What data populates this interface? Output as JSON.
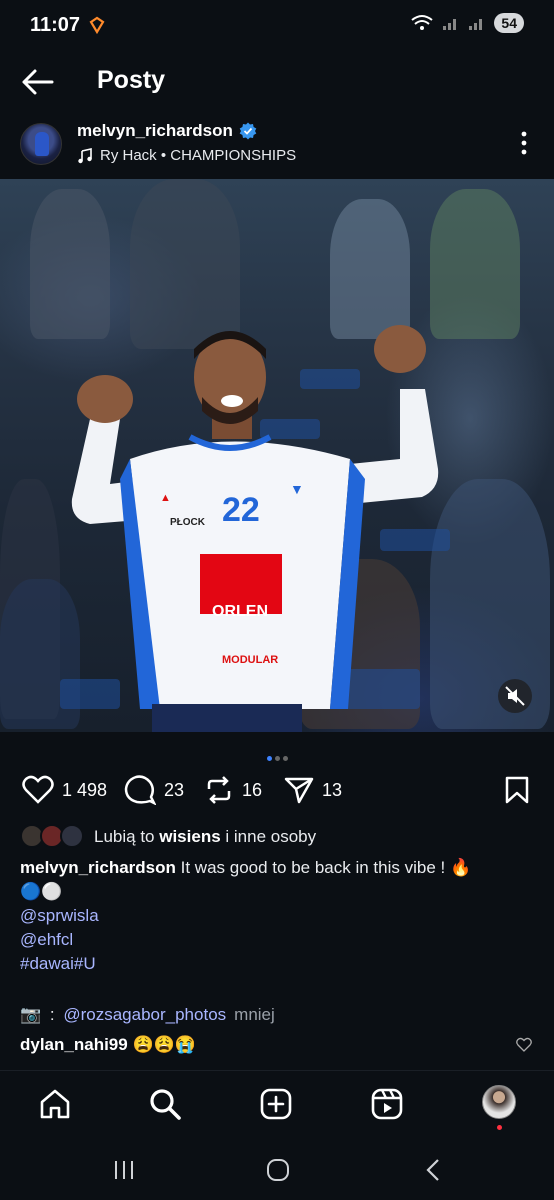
{
  "status_bar": {
    "time": "11:07",
    "battery": "54"
  },
  "header": {
    "title": "Posty"
  },
  "post": {
    "username": "melvyn_richardson",
    "music": "Ry Hack • CHAMPIONSHIPS",
    "carousel": {
      "total": 3,
      "active": 1
    },
    "likes": "1 498",
    "comments": "23",
    "reposts": "16",
    "shares": "13",
    "liked_by_prefix": "Lubią to ",
    "liked_by_user": "wisiens",
    "liked_by_suffix": " i inne osoby",
    "caption_user": "melvyn_richardson",
    "caption_text": " It was good to be back in this vibe ! 🔥",
    "caption_emoji": "🔵⚪",
    "mentions": [
      "@sprwisla",
      "@ehfcl",
      "#dawai#U"
    ],
    "credit_icon": "📷",
    "credit_sep": " : ",
    "credit_user": "@rozsagabor_photos",
    "credit_more": "mniej",
    "comment_user": "dylan_nahi99",
    "comment_emoji": "😩😩😭"
  },
  "jersey": {
    "number": "22",
    "sponsor": "ORLEN",
    "club": "PŁOCK",
    "brand": "MODULAR"
  },
  "colors": {
    "accent_blue": "#3d82ff",
    "verified": "#3897f0",
    "link": "#a9b6ff",
    "orlen_red": "#e30613"
  },
  "icons": [
    "back-arrow-icon",
    "verified-icon",
    "music-note-icon",
    "more-icon",
    "heart-icon",
    "comment-icon",
    "repost-icon",
    "share-icon",
    "bookmark-icon",
    "home-icon",
    "search-icon",
    "add-icon",
    "reels-icon",
    "mute-icon"
  ]
}
